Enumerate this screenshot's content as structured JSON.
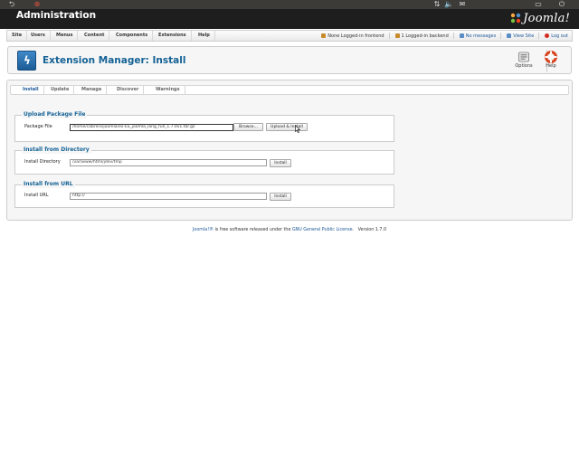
{
  "admin": {
    "title": "Administration",
    "logo_text": "Joomla!"
  },
  "menu": {
    "items": [
      "Site",
      "Users",
      "Menus",
      "Content",
      "Components",
      "Extensions",
      "Help"
    ]
  },
  "status": {
    "frontend": "None Logged-in frontend",
    "backend": "1 Logged-in backend",
    "messages": "No messages",
    "view_site": "View Site",
    "logout": "Log out"
  },
  "toolbar": {
    "page_title": "Extension Manager: Install",
    "options_label": "Options",
    "help_label": "Help"
  },
  "subnav": {
    "tabs": [
      "Install",
      "Update",
      "Manage",
      "Discover",
      "Warnings"
    ],
    "active": "Install"
  },
  "upload": {
    "legend": "Upload Package File",
    "label": "Package File",
    "value": "/home/cabrero/joomla/es-ES_joomla_lang_full_1.7.0v1.tar.gz",
    "browse_label": "Browse...",
    "button_label": "Upload & Install"
  },
  "directory": {
    "legend": "Install from Directory",
    "label": "Install Directory",
    "value": "/var/www/html/jdev/tmp",
    "button_label": "Install"
  },
  "url": {
    "legend": "Install from URL",
    "label": "Install URL",
    "value": "http://",
    "button_label": "Install"
  },
  "footer": {
    "link1": "Joomla!®",
    "text1": " is free software released under the ",
    "link2": "GNU General Public License",
    "text2": ".",
    "version": "Version 1.7.0"
  },
  "colors": {
    "accent": "#146295",
    "link": "#1c5899",
    "header_bg": "#1e1e1e"
  }
}
